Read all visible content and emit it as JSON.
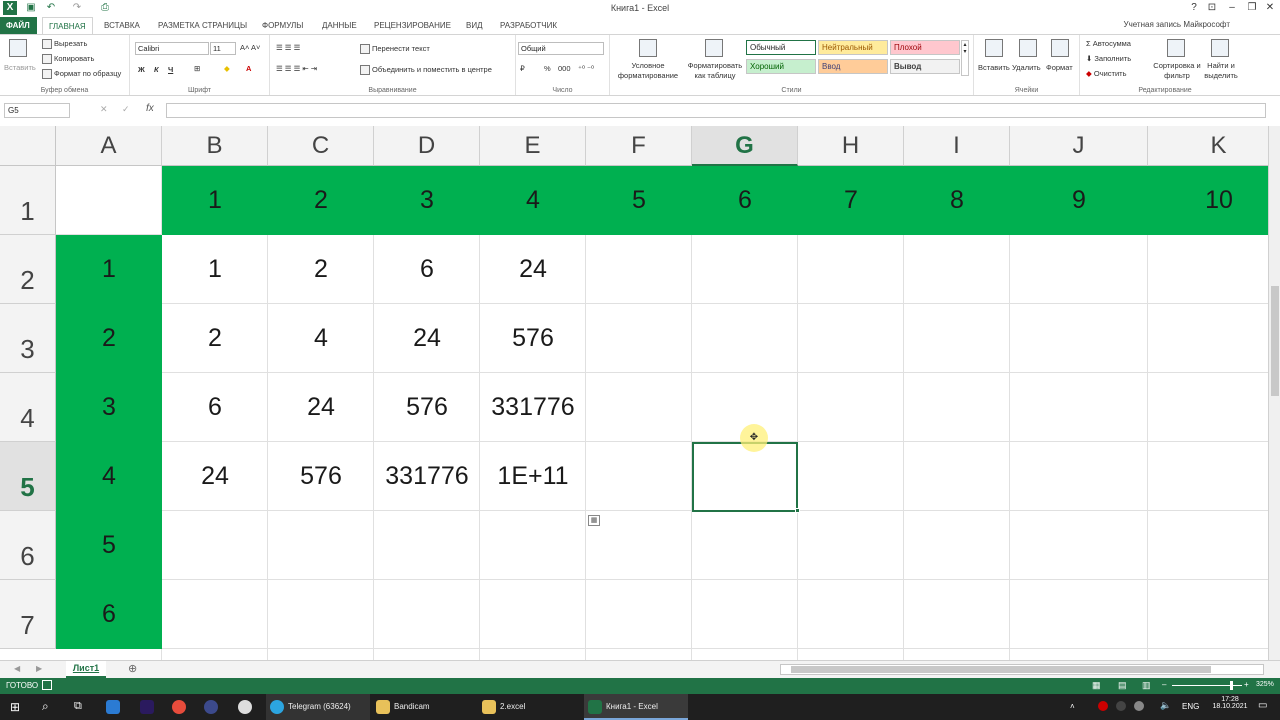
{
  "window": {
    "title": "Книга1 - Excel",
    "account": "Учетная запись Майкрософт",
    "controls": [
      "?",
      "⊡",
      "–",
      "❐",
      "✕"
    ]
  },
  "tabs": [
    {
      "label": "ФАЙЛ"
    },
    {
      "label": "ГЛАВНАЯ"
    },
    {
      "label": "ВСТАВКА"
    },
    {
      "label": "РАЗМЕТКА СТРАНИЦЫ"
    },
    {
      "label": "ФОРМУЛЫ"
    },
    {
      "label": "ДАННЫЕ"
    },
    {
      "label": "РЕЦЕНЗИРОВАНИЕ"
    },
    {
      "label": "ВИД"
    },
    {
      "label": "РАЗРАБОТЧИК"
    }
  ],
  "ribbon": {
    "clipboard": {
      "label": "Буфер обмена",
      "paste": "Вставить",
      "cut": "Вырезать",
      "copy": "Копировать",
      "format_painter": "Формат по образцу"
    },
    "font": {
      "label": "Шрифт",
      "name": "Calibri",
      "size": "11",
      "bold": "Ж",
      "italic": "К",
      "underline": "Ч"
    },
    "alignment": {
      "label": "Выравнивание",
      "wrap": "Перенести текст",
      "merge": "Объединить и поместить в центре"
    },
    "number": {
      "label": "Число",
      "format": "Общий",
      "percent": "%",
      "thousands": "000"
    },
    "styles": {
      "label": "Стили",
      "cond": "Условное форматирование",
      "table": "Форматировать как таблицу",
      "normal": "Обычный",
      "neutral": "Нейтральный",
      "bad": "Плохой",
      "good": "Хороший",
      "input": "Ввод",
      "output": "Вывод"
    },
    "cells": {
      "label": "Ячейки",
      "insert": "Вставить",
      "delete": "Удалить",
      "format": "Формат"
    },
    "editing": {
      "label": "Редактирование",
      "autosum": "Автосумма",
      "fill": "Заполнить",
      "clear": "Очистить",
      "sort": "Сортировка и фильтр",
      "find": "Найти и выделить"
    }
  },
  "formula_bar": {
    "name_box": "G5",
    "fx": "fx",
    "value": ""
  },
  "columns": [
    "A",
    "B",
    "C",
    "D",
    "E",
    "F",
    "G",
    "H",
    "I",
    "J",
    "K"
  ],
  "rows": [
    "1",
    "2",
    "3",
    "4",
    "5",
    "6",
    "7"
  ],
  "selected_cell": "G5",
  "cells": {
    "row1": [
      "",
      "1",
      "2",
      "3",
      "4",
      "5",
      "6",
      "7",
      "8",
      "9",
      "10"
    ],
    "row2": [
      "1",
      "1",
      "2",
      "6",
      "24",
      "",
      "",
      "",
      "",
      "",
      ""
    ],
    "row3": [
      "2",
      "2",
      "4",
      "24",
      "576",
      "",
      "",
      "",
      "",
      "",
      ""
    ],
    "row4": [
      "3",
      "6",
      "24",
      "576",
      "331776",
      "",
      "",
      "",
      "",
      "",
      ""
    ],
    "row5": [
      "4",
      "24",
      "576",
      "331776",
      "1E+11",
      "",
      "",
      "",
      "",
      "",
      ""
    ],
    "row6": [
      "5",
      "",
      "",
      "",
      "",
      "",
      "",
      "",
      "",
      "",
      ""
    ],
    "row7": [
      "6",
      "",
      "",
      "",
      "",
      "",
      "",
      "",
      "",
      "",
      ""
    ]
  },
  "colors": {
    "green": "#00b050",
    "excel": "#217346"
  },
  "sheet": {
    "name": "Лист1"
  },
  "status": {
    "mode": "ГОТОВО",
    "zoom": "325%"
  },
  "taskbar": {
    "items": [
      "Telegram (63624)",
      "Bandicam",
      "2.excel",
      "Книга1 - Excel"
    ],
    "lang": "ENG",
    "time": "17:28",
    "date": "18.10.2021"
  }
}
